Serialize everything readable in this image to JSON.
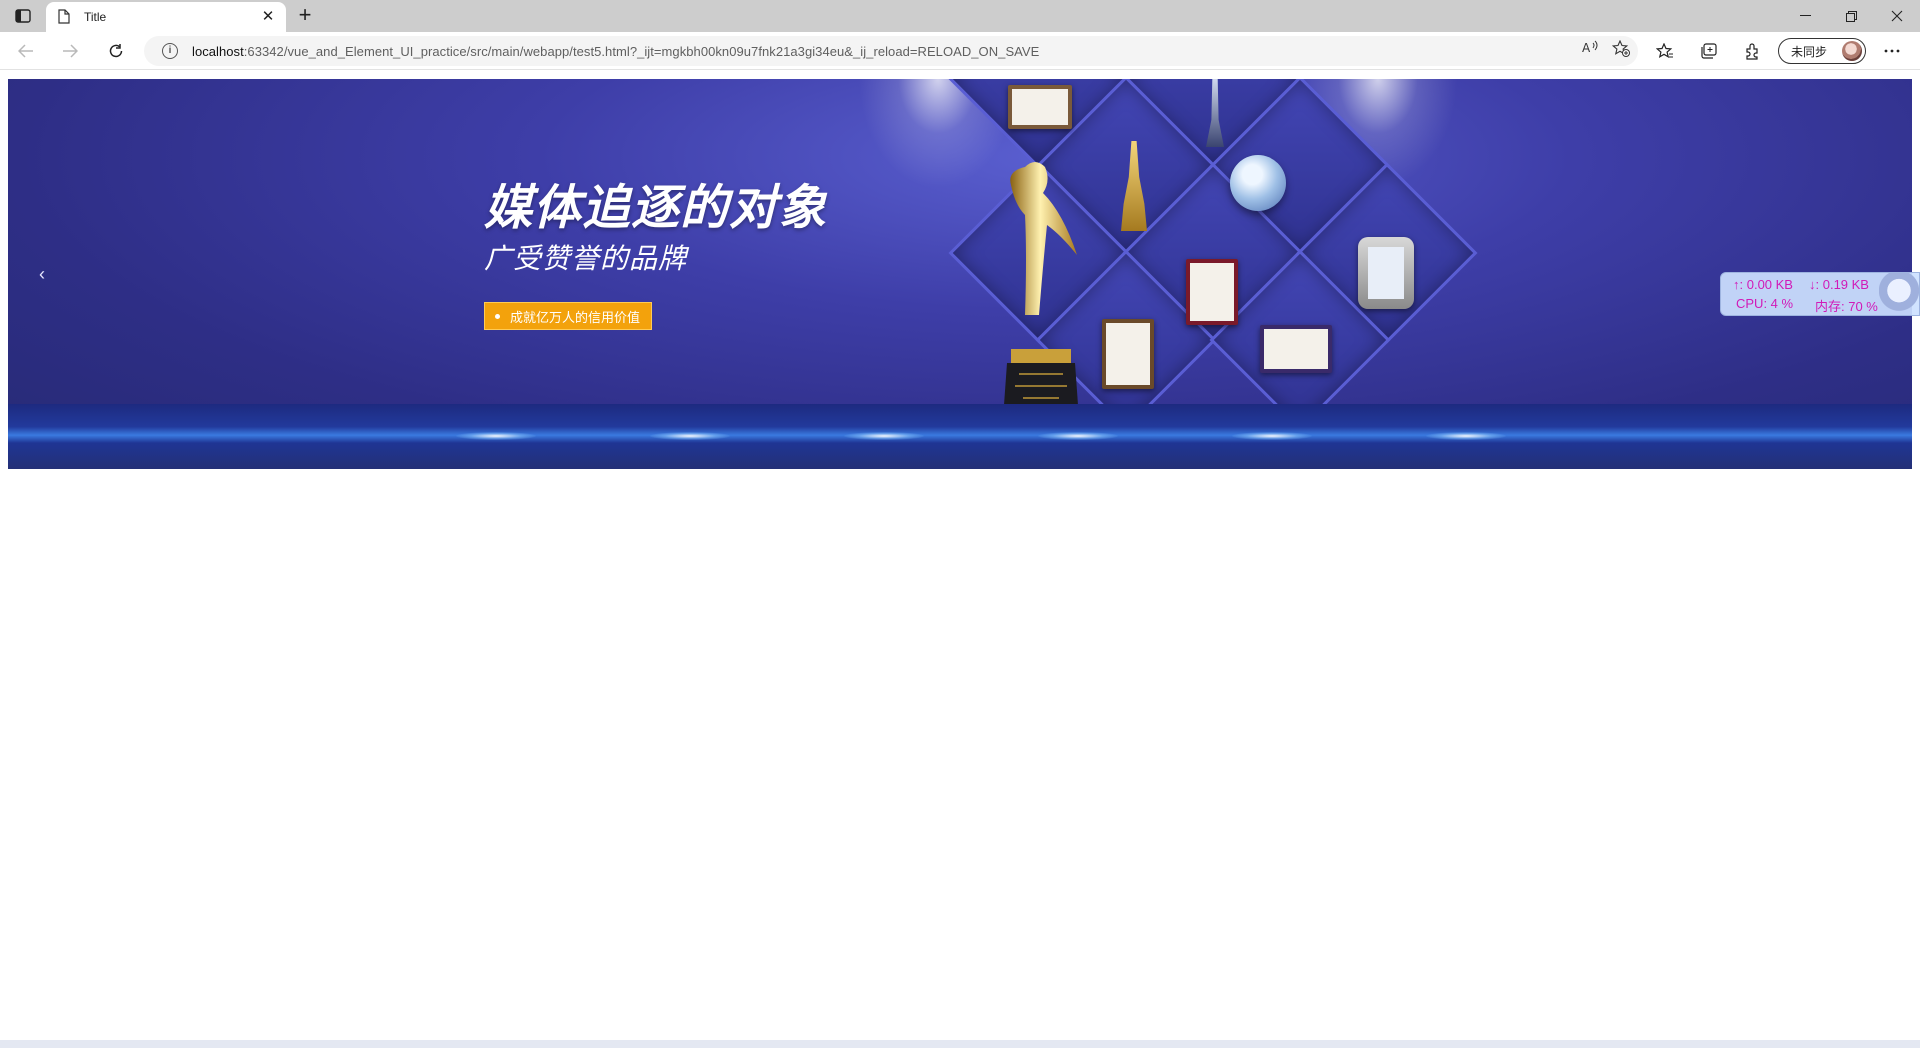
{
  "browser": {
    "tab": {
      "title": "Title"
    },
    "address": {
      "host": "localhost",
      "path": ":63342/vue_and_Element_UI_practice/src/main/webapp/test5.html?_ijt=mgkbh00kn09u7fnk21a3gi34eu&_ij_reload=RELOAD_ON_SAVE"
    },
    "profile": {
      "sync_label": "未同步"
    },
    "icons": [
      "tab-actions-icon",
      "document-icon",
      "close-icon",
      "plus-icon",
      "minimize-icon",
      "restore-icon",
      "window-close-icon",
      "back-icon",
      "forward-icon",
      "refresh-icon",
      "info-icon",
      "read-aloud-icon",
      "add-favorite-icon",
      "favorites-icon",
      "collections-icon",
      "extensions-icon",
      "more-icon"
    ]
  },
  "banner": {
    "headline": "媒体追逐的对象",
    "subline": "广受赞誉的品牌",
    "cta_label": "成就亿万人的信用价值",
    "prev_arrow": "‹",
    "colors": {
      "background": "#3e3ea8",
      "cta": "#f3a20c"
    }
  },
  "netspeed": {
    "up": "↑: 0.00 KB",
    "down": "↓: 0.19 KB",
    "cpu": "CPU: 4 %",
    "mem": "内存: 70 %",
    "color": "#d11ab8"
  }
}
